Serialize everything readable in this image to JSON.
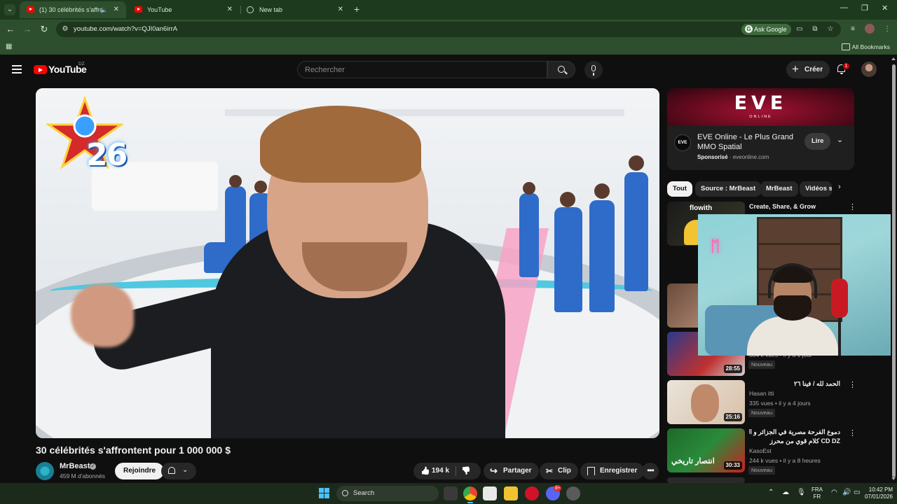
{
  "browser": {
    "tabs": [
      {
        "title": "(1) 30 célébrités s'affronten",
        "active": true,
        "audio": true
      },
      {
        "title": "YouTube",
        "active": false
      },
      {
        "title": "New tab",
        "active": false
      }
    ],
    "url": "youtube.com/watch?v=QJI0an6irrA",
    "ask_google": "Ask Google",
    "all_bookmarks": "All Bookmarks"
  },
  "youtube": {
    "logo_text": "YouTube",
    "region": "DZ",
    "search_placeholder": "Rechercher",
    "create_label": "Créer",
    "notification_count": "1"
  },
  "video": {
    "title": "30 célébrités s'affrontent pour 1 000 000 $",
    "channel": "MrBeast",
    "subscribers": "459 M d'abonnés",
    "join_label": "Rejoindre",
    "likes": "194 k",
    "share_label": "Partager",
    "clip_label": "Clip",
    "save_label": "Enregistrer",
    "overlay_logo_text": "26"
  },
  "ad": {
    "banner_text": "EVE",
    "banner_subtext": "ONLINE",
    "logo_text": "EVE",
    "title": "EVE Online - Le Plus Grand MMO Spatial",
    "sponsored": "Sponsorisé",
    "domain": "eveonline.com",
    "cta": "Lire"
  },
  "chips": [
    "Tout",
    "Source : MrBeast",
    "MrBeast",
    "Vidéos s"
  ],
  "recommendations": [
    {
      "title": "Create, Share, & Grow",
      "channel": "",
      "stats": "",
      "duration": "",
      "badge": "",
      "thumb_text": "flowith"
    },
    {
      "title": "",
      "channel": "",
      "stats": "",
      "duration": "",
      "badge": ""
    },
    {
      "title": "",
      "channel": "",
      "stats": "384 k vues • il y a 1 jour",
      "duration": "28:55",
      "badge": "Nouveau"
    },
    {
      "title": "الحمد لله / فينا ٢٦",
      "channel": "Hasan itti",
      "stats": "335 vues • il y a 4 jours",
      "duration": "25:16",
      "badge": "Nouveau"
    },
    {
      "title": "دموع الفرحة مصرية في الجزائر و الكونغو",
      "title2": "CD DZ كلام قوي من محرز",
      "channel": "KasoEst",
      "stats": "244 k vues • il y a 8 heures",
      "duration": "30:33",
      "badge": "Nouveau",
      "thumb_text": "انتصار تاريخي"
    }
  ],
  "taskbar": {
    "search_label": "Search",
    "lang_top": "FRA",
    "lang_bottom": "FR",
    "time": "10:42 PM",
    "date": "07/01/2026",
    "discord_badge": "9+"
  }
}
